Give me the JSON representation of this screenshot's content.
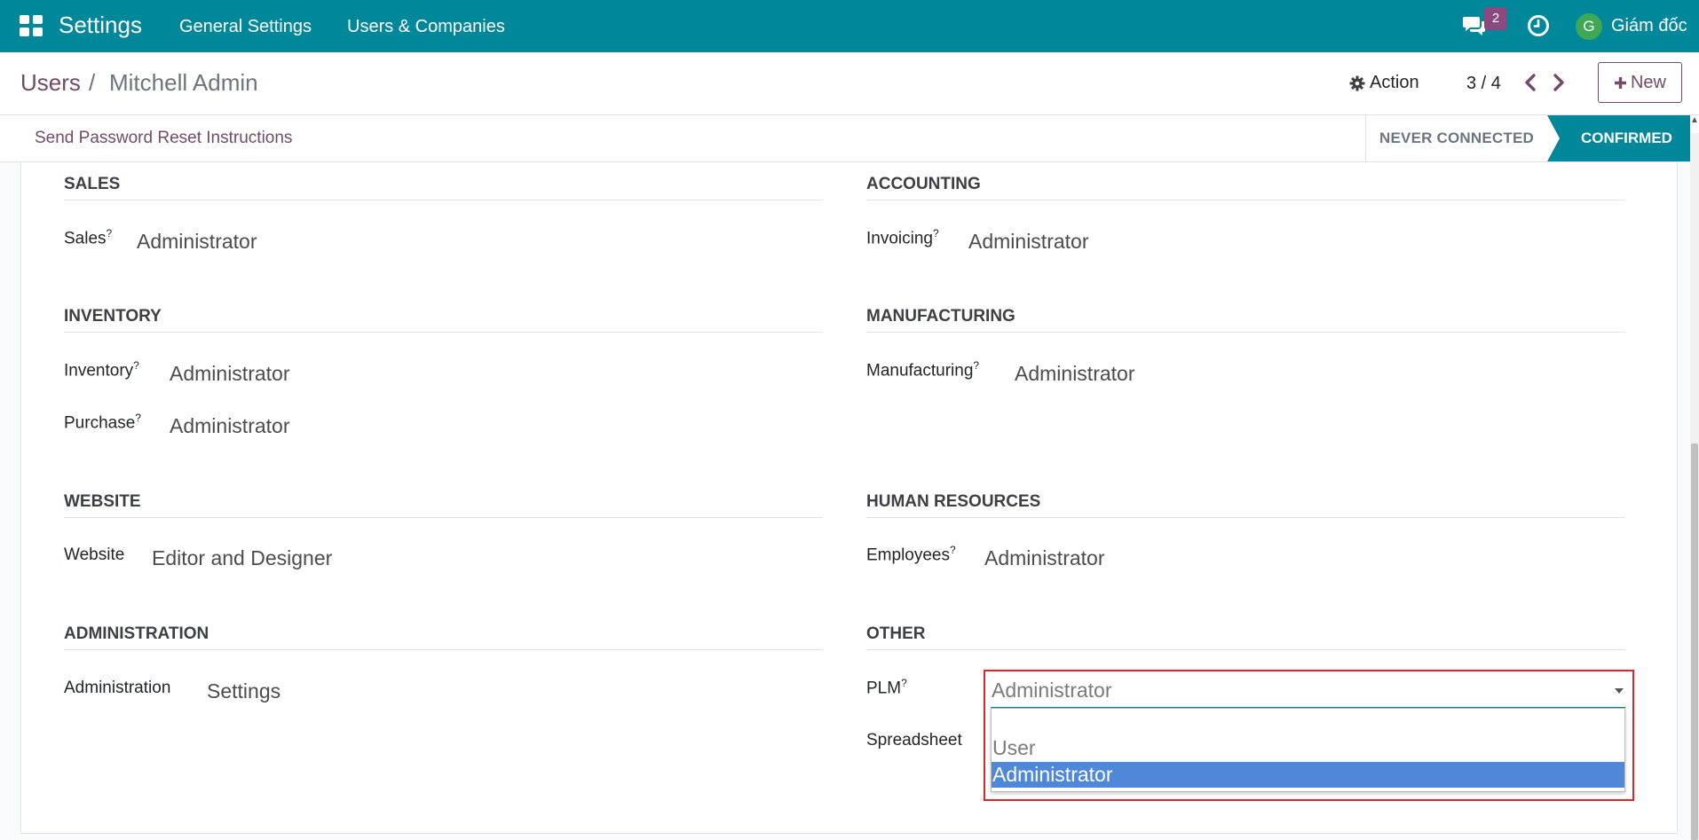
{
  "navbar": {
    "app_name": "Settings",
    "menus": [
      "General Settings",
      "Users & Companies"
    ],
    "chat_count": "2",
    "user_initial": "G",
    "user_name": "Giám đốc",
    "color": "#00889a"
  },
  "breadcrumb": {
    "parent": "Users",
    "separator": "/",
    "current": "Mitchell Admin"
  },
  "controls": {
    "action_label": "Action",
    "pager": "3 / 4",
    "new_label": "New"
  },
  "statusbar": {
    "reset_link": "Send Password Reset Instructions",
    "stages": [
      "NEVER CONNECTED",
      "CONFIRMED"
    ],
    "active_stage": "CONFIRMED"
  },
  "sections": {
    "sales": {
      "title": "SALES",
      "fields": [
        {
          "label": "Sales",
          "help": "?",
          "value": "Administrator"
        }
      ]
    },
    "accounting": {
      "title": "ACCOUNTING",
      "fields": [
        {
          "label": "Invoicing",
          "help": "?",
          "value": "Administrator"
        }
      ]
    },
    "inventory": {
      "title": "INVENTORY",
      "fields": [
        {
          "label": "Inventory",
          "help": "?",
          "value": "Administrator"
        },
        {
          "label": "Purchase",
          "help": "?",
          "value": "Administrator"
        }
      ]
    },
    "manufacturing": {
      "title": "MANUFACTURING",
      "fields": [
        {
          "label": "Manufacturing",
          "help": "?",
          "value": "Administrator"
        }
      ]
    },
    "website": {
      "title": "WEBSITE",
      "fields": [
        {
          "label": "Website",
          "value": "Editor and Designer"
        }
      ]
    },
    "hr": {
      "title": "HUMAN RESOURCES",
      "fields": [
        {
          "label": "Employees",
          "help": "?",
          "value": "Administrator"
        }
      ]
    },
    "administration": {
      "title": "ADMINISTRATION",
      "fields": [
        {
          "label": "Administration",
          "value": "Settings"
        }
      ]
    },
    "other": {
      "title": "OTHER",
      "fields": [
        {
          "label": "PLM",
          "help": "?",
          "value": "Administrator"
        },
        {
          "label": "Spreadsheet"
        }
      ]
    }
  },
  "plm_dropdown": {
    "selected": "Administrator",
    "options": [
      "",
      "User",
      "Administrator"
    ],
    "highlighted": "Administrator"
  }
}
